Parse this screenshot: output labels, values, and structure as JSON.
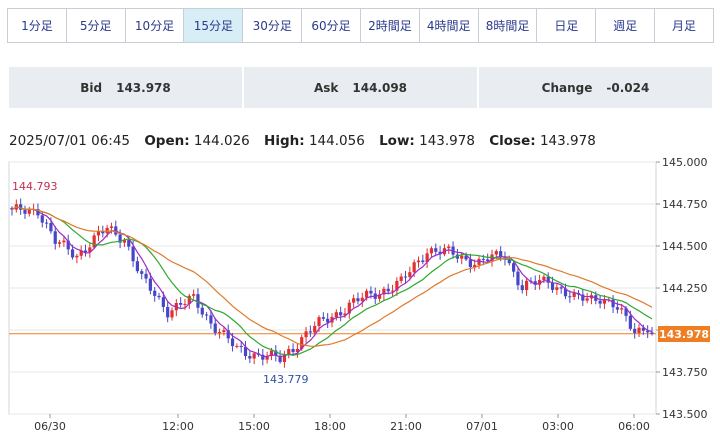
{
  "tabs": [
    "1分足",
    "5分足",
    "10分足",
    "15分足",
    "30分足",
    "60分足",
    "2時間足",
    "4時間足",
    "8時間足",
    "日足",
    "週足",
    "月足"
  ],
  "active_tab": 3,
  "quote": {
    "bid_label": "Bid",
    "bid_value": "143.978",
    "ask_label": "Ask",
    "ask_value": "144.098",
    "change_label": "Change",
    "change_value": "-0.024"
  },
  "ohlc": {
    "datetime": "2025/07/01 06:45",
    "open_label": "Open:",
    "open_value": "144.026",
    "high_label": "High:",
    "high_value": "144.056",
    "low_label": "Low:",
    "low_value": "143.978",
    "close_label": "Close:",
    "close_value": "143.978"
  },
  "chart_data": {
    "type": "candlestick",
    "ylim": [
      143.5,
      145.0
    ],
    "y_ticks": [
      "145.000",
      "144.750",
      "144.500",
      "144.250",
      "144.000",
      "143.750",
      "143.500"
    ],
    "x_ticks": [
      "06/30",
      "12:00",
      "15:00",
      "18:00",
      "21:00",
      "07/01",
      "03:00",
      "06:00"
    ],
    "current_price": 143.978,
    "current_price_label": "143.978",
    "high_marker": "144.793",
    "low_marker": "143.779",
    "up_color": "#e03030",
    "down_color": "#4646c8",
    "series": [
      {
        "name": "ma_short",
        "color": "#9b2dc8"
      },
      {
        "name": "ma_mid",
        "color": "#2ea82e"
      },
      {
        "name": "ma_long",
        "color": "#e07a2a"
      }
    ]
  }
}
